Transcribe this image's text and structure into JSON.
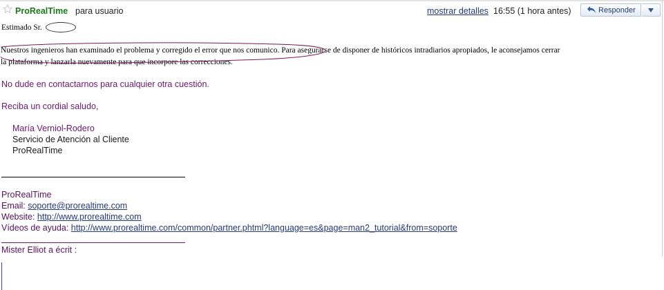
{
  "header": {
    "sender": "ProRealTime",
    "recipient_text": "para usuario",
    "details_link": "mostrar detalles",
    "time": "16:55 (1 hora antes)",
    "reply_label": "Responder"
  },
  "body": {
    "greeting": "Estimado Sr.",
    "paragraph1_line1": "Nuestros ingenieros han examinado el problema y corregido el error que nos comunico. Para asegurarse de disponer de históricos intradiarios apropiados, le aconsejamos cerrar",
    "paragraph1_line2": "la plataforma y lanzarla nuevamente para que incorpore las correcciones.",
    "paragraph2": "No dude en contactarnos para cualquier otra cuestión.",
    "closing": "Reciba un cordial saludo,",
    "signature": {
      "name": "María Verniol-Rodero",
      "role": "Servicio de Atención al Cliente",
      "company": "ProRealTime"
    }
  },
  "footer": {
    "company": "ProRealTime",
    "email_label": "Email:",
    "email": "soporte@prorealtime.com",
    "website_label": "Website:",
    "website": "http://www.prorealtime.com",
    "videos_label": "Vídeos de ayuda:",
    "videos_url": "http://www.prorealtime.com/common/partner.phtml?language=es&page=man2_tutorial&from=soporte"
  },
  "quote": {
    "wrote": "Mister Elliot a écrit :"
  },
  "colors": {
    "sender_green": "#1a7a1a",
    "link_blue": "#23397a",
    "text_purple": "#6a1670",
    "annotation": "#7a1a5a"
  },
  "icons": {
    "star": "star-icon",
    "reply": "reply-arrow-icon",
    "more": "dropdown-arrow-icon"
  }
}
